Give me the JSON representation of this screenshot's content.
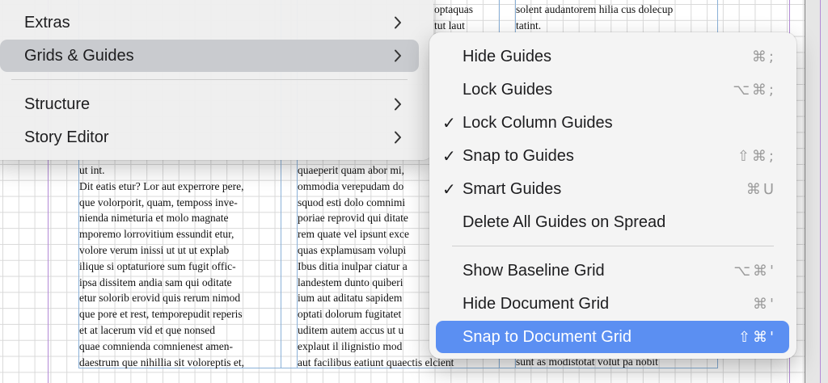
{
  "document": {
    "col1_text": "ut int.\nDit eatis etur? Lor aut experrore pere,\nque volorporit, quam, temposs inve-\nnienda nimeturia et molo magnate\nmporemo lorrovitium essundit etur,\nvolore verum inissi ut ut ut explab\nilique si optaturiore sum fugit offic-\nipsa dissitem andia sam qui oditate\netur solorib erovid quis rerum nimod\nque pore et rest, temporepudit reperis\net at lacerum vid et que nonsed\nquae comnienda comnienest amen-\ndaestrum que nihillia sit voloreptis et,",
    "col2_top_text": "optaquas\ntut laut",
    "col2_text": "quaeperit quam abor mi,\nommodia verepudam do\nsquod esti dolo comnimi\nporiae reprovid qui ditate\nrem quate vel ipsunt exce\nquas explamusam volupi\nIbus ditia inulpar ciatur a\nlandestem dunto quiberi\nium aut aditatu sapidem\noptati dolorum fugitatet\nuditem autem accus ut u\nexplaut il ilignistio mod\naut facilibus eatiunt quaectis elcient",
    "col3_top_text": "solent audantorem hilia cus dolecup\ntatint.",
    "col3_bottom_text": "sunt as modistotat volut pa nobit"
  },
  "main_menu": {
    "items": [
      {
        "label": "Extras"
      },
      {
        "label": "Grids & Guides"
      },
      {
        "label": "Structure"
      },
      {
        "label": "Story Editor"
      }
    ]
  },
  "submenu": {
    "items": [
      {
        "label": "Hide Guides",
        "shortcut": "⌘;",
        "checked": false
      },
      {
        "label": "Lock Guides",
        "shortcut": "⌥⌘;",
        "checked": false
      },
      {
        "label": "Lock Column Guides",
        "shortcut": "",
        "checked": true
      },
      {
        "label": "Snap to Guides",
        "shortcut": "⇧⌘;",
        "checked": true
      },
      {
        "label": "Smart Guides",
        "shortcut": "⌘U",
        "checked": true
      },
      {
        "label": "Delete All Guides on Spread",
        "shortcut": "",
        "checked": false
      },
      {
        "label": "Show Baseline Grid",
        "shortcut": "⌥⌘'",
        "checked": false
      },
      {
        "label": "Hide Document Grid",
        "shortcut": "⌘'",
        "checked": false
      },
      {
        "label": "Snap to Document Grid",
        "shortcut": "⇧⌘'",
        "checked": false,
        "selected": true
      }
    ],
    "check_glyph": "✓"
  },
  "colors": {
    "selection": "#5b8ff2",
    "submenu_highlight": "#c9cbcf",
    "guide_purple": "#b38ad6",
    "column_guide_blue": "#8bb1d8"
  }
}
